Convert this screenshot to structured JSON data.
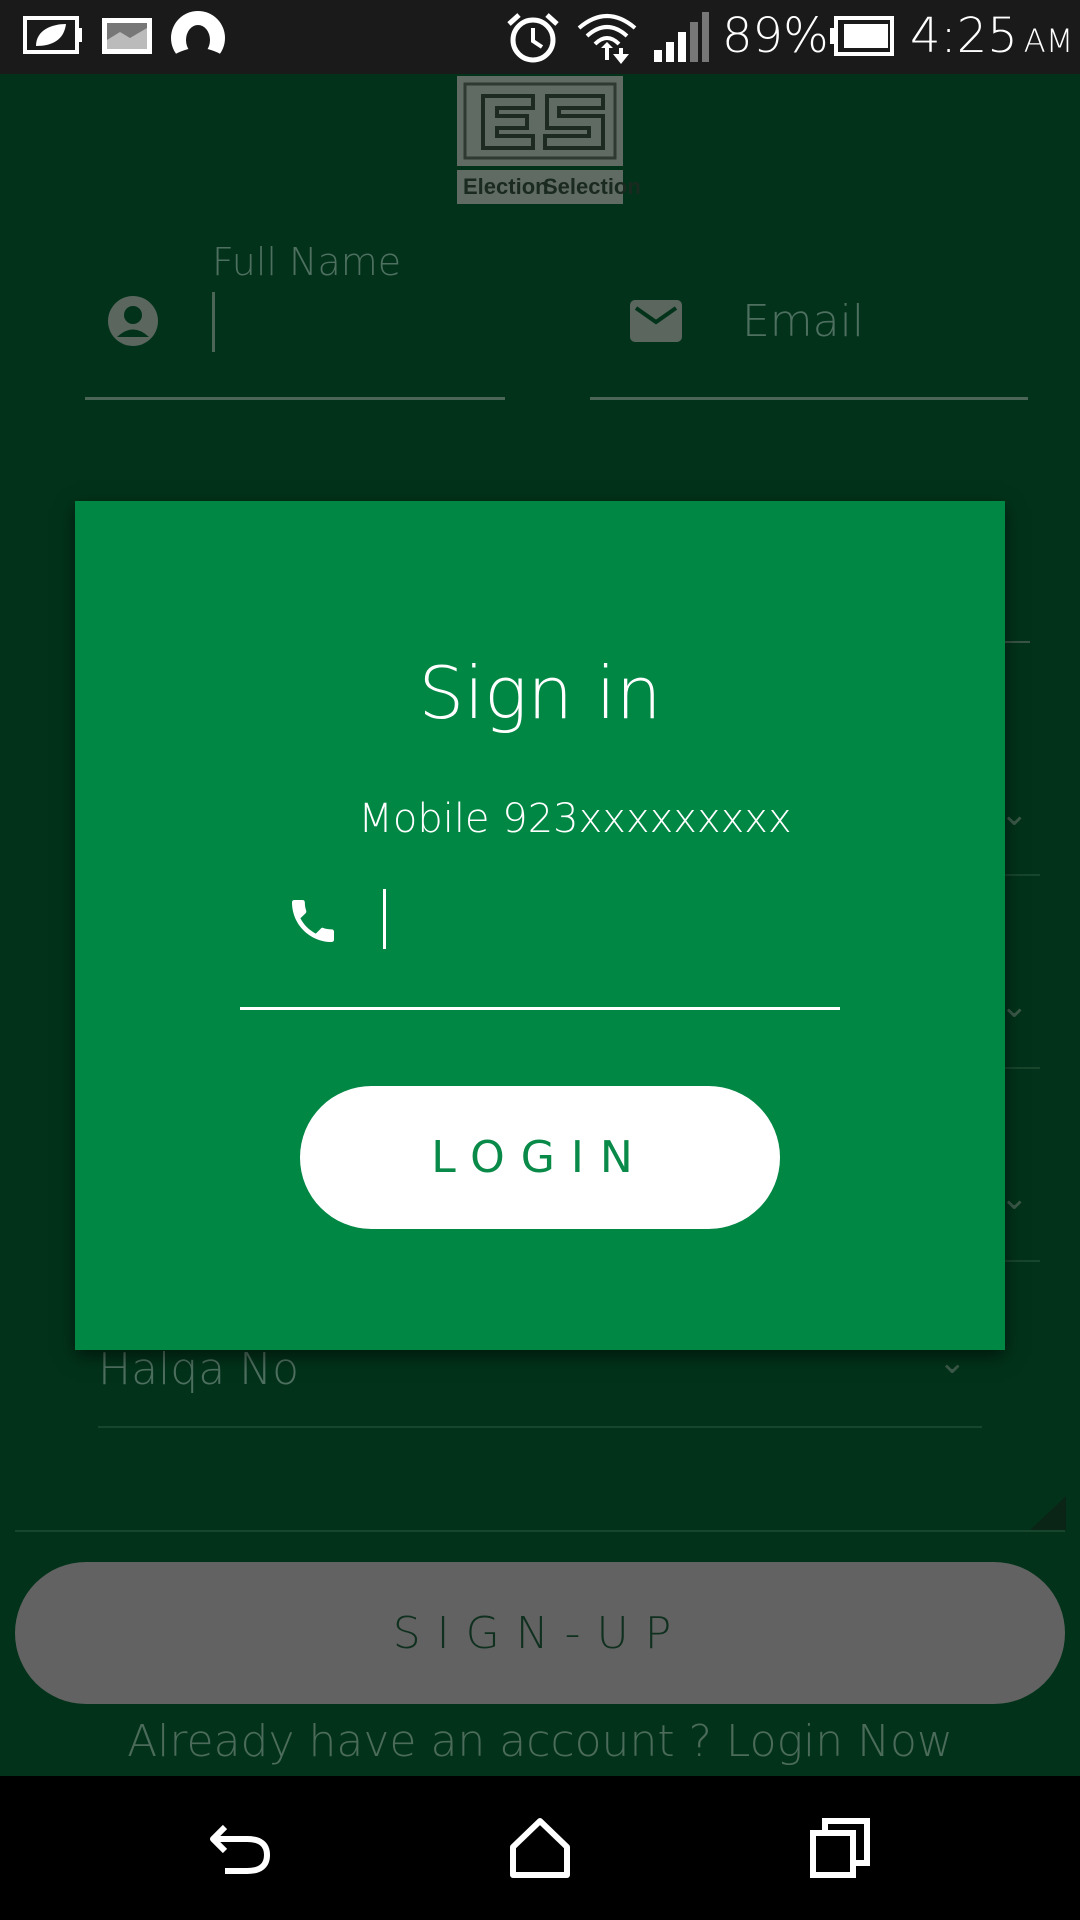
{
  "status_bar": {
    "battery_percent": "89%",
    "time": "4:25",
    "ampm": "AM",
    "icons": [
      "eco-battery-icon",
      "gallery-icon",
      "owl-app-icon",
      "alarm-icon",
      "wifi-icon",
      "signal-icon",
      "battery-icon"
    ]
  },
  "logo": {
    "letters": "ES",
    "text_left": "Election",
    "text_right": "Selection"
  },
  "form": {
    "full_name_label": "Full Name",
    "email_placeholder": "Email",
    "halqa_label": "Halqa No",
    "signup_label": "SIGN-UP",
    "already_text": "Already have an account ? Login Now"
  },
  "dialog": {
    "title": "Sign in",
    "mobile_hint": "Mobile 923xxxxxxxxx",
    "phone_value": "",
    "login_label": "LOGIN"
  },
  "colors": {
    "dialog_bg": "#008744",
    "screen_dim": "#02331a",
    "button_white": "#ffffff"
  },
  "navbar": {
    "icons": [
      "back-icon",
      "home-icon",
      "recents-icon"
    ]
  }
}
